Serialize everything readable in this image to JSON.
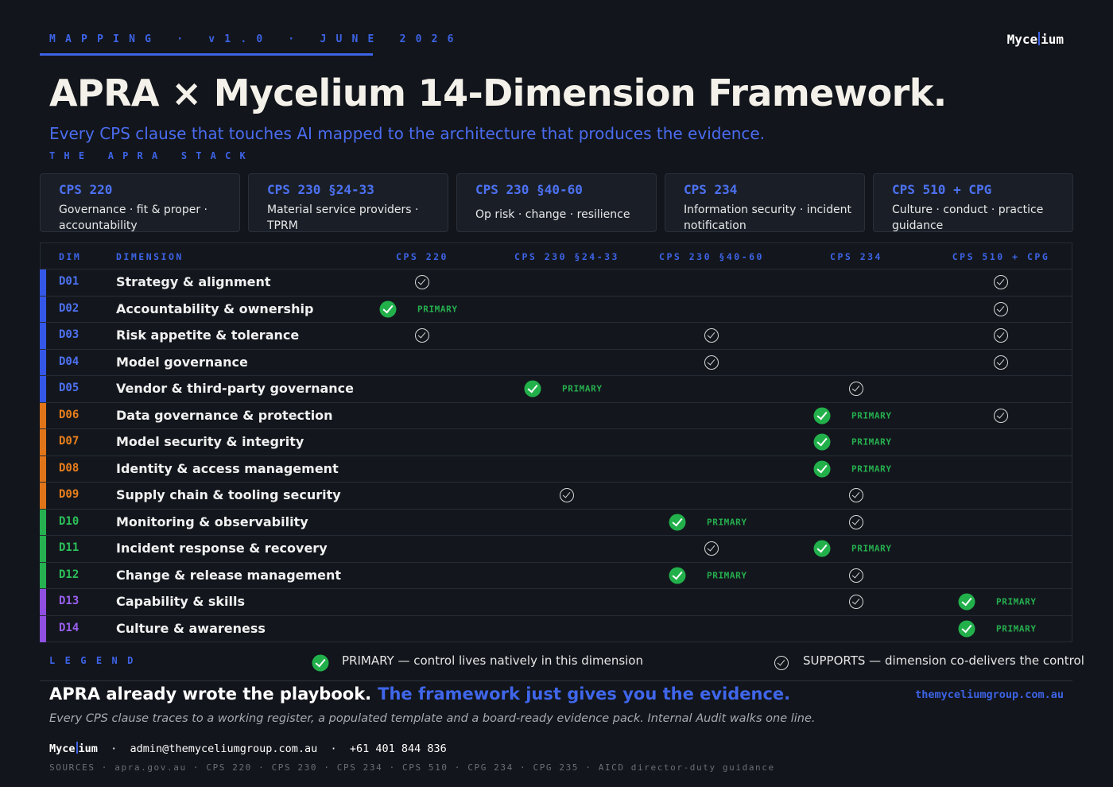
{
  "header": {
    "kicker": "MAPPING · v1.0 · JUNE 2026",
    "brand_left": "Myce",
    "brand_right": "ium",
    "title": "APRA × Mycelium 14-Dimension Framework.",
    "subtitle": "Every CPS clause that touches AI mapped to the architecture that produces the evidence.",
    "stack_label": "THE APRA STACK"
  },
  "stack": [
    {
      "title": "CPS 220",
      "desc": "Governance · fit & proper · accountability"
    },
    {
      "title": "CPS 230 §24-33",
      "desc": "Material service providers · TPRM"
    },
    {
      "title": "CPS 230 §40-60",
      "desc": "Op risk · change · resilience"
    },
    {
      "title": "CPS 234",
      "desc": "Information security · incident notification"
    },
    {
      "title": "CPS 510 + CPG",
      "desc": "Culture · conduct · practice guidance"
    }
  ],
  "table": {
    "col_dim": "DIM",
    "col_dimension": "DIMENSION",
    "columns": [
      "CPS 220",
      "CPS 230 §24-33",
      "CPS 230 §40-60",
      "CPS 234",
      "CPS 510 + CPG"
    ],
    "primary_tag": "PRIMARY",
    "rows": [
      {
        "id": "D01",
        "name": "Strategy & alignment",
        "group": "blue",
        "marks": [
          "S",
          "",
          "",
          "",
          "S"
        ]
      },
      {
        "id": "D02",
        "name": "Accountability & ownership",
        "group": "blue",
        "marks": [
          "P",
          "",
          "",
          "",
          "S"
        ]
      },
      {
        "id": "D03",
        "name": "Risk appetite & tolerance",
        "group": "blue",
        "marks": [
          "S",
          "",
          "S",
          "",
          "S"
        ]
      },
      {
        "id": "D04",
        "name": "Model governance",
        "group": "blue",
        "marks": [
          "",
          "",
          "S",
          "",
          "S"
        ]
      },
      {
        "id": "D05",
        "name": "Vendor & third-party governance",
        "group": "blue",
        "marks": [
          "",
          "P",
          "",
          "S",
          ""
        ]
      },
      {
        "id": "D06",
        "name": "Data governance & protection",
        "group": "orange",
        "marks": [
          "",
          "",
          "",
          "P",
          "S"
        ]
      },
      {
        "id": "D07",
        "name": "Model security & integrity",
        "group": "orange",
        "marks": [
          "",
          "",
          "",
          "P",
          ""
        ]
      },
      {
        "id": "D08",
        "name": "Identity & access management",
        "group": "orange",
        "marks": [
          "",
          "",
          "",
          "P",
          ""
        ]
      },
      {
        "id": "D09",
        "name": "Supply chain & tooling security",
        "group": "orange",
        "marks": [
          "",
          "S",
          "",
          "S",
          ""
        ]
      },
      {
        "id": "D10",
        "name": "Monitoring & observability",
        "group": "green",
        "marks": [
          "",
          "",
          "P",
          "S",
          ""
        ]
      },
      {
        "id": "D11",
        "name": "Incident response & recovery",
        "group": "green",
        "marks": [
          "",
          "",
          "S",
          "P",
          ""
        ]
      },
      {
        "id": "D12",
        "name": "Change & release management",
        "group": "green",
        "marks": [
          "",
          "",
          "P",
          "S",
          ""
        ]
      },
      {
        "id": "D13",
        "name": "Capability & skills",
        "group": "purple",
        "marks": [
          "",
          "",
          "",
          "S",
          "P"
        ]
      },
      {
        "id": "D14",
        "name": "Culture & awareness",
        "group": "purple",
        "marks": [
          "",
          "",
          "",
          "",
          "P"
        ]
      }
    ]
  },
  "group_colors": {
    "blue": "#3557e8",
    "orange": "#e07418",
    "green": "#26b04f",
    "purple": "#8f4fe0"
  },
  "dim_text_colors": {
    "blue": "#4d71f2",
    "orange": "#ea7f1c",
    "green": "#2cc05a",
    "purple": "#9a5ff0"
  },
  "legend": {
    "label": "LEGEND",
    "primary": "PRIMARY — control lives natively in this dimension",
    "supports": "SUPPORTS — dimension co-delivers the control"
  },
  "footer": {
    "tagline_a": "APRA already wrote the playbook.",
    "tagline_b": "The framework just gives you the evidence.",
    "site": "themyceliumgroup.com.au",
    "note": "Every CPS clause traces to a working register, a populated template and a board-ready evidence pack. Internal Audit walks one line.",
    "email": "admin@themyceliumgroup.com.au",
    "phone": "+61 401 844 836",
    "sources": "SOURCES · apra.gov.au · CPS 220 · CPS 230 · CPS 234 · CPS 510 · CPG 234 · CPG 235 · AICD director-duty guidance"
  }
}
